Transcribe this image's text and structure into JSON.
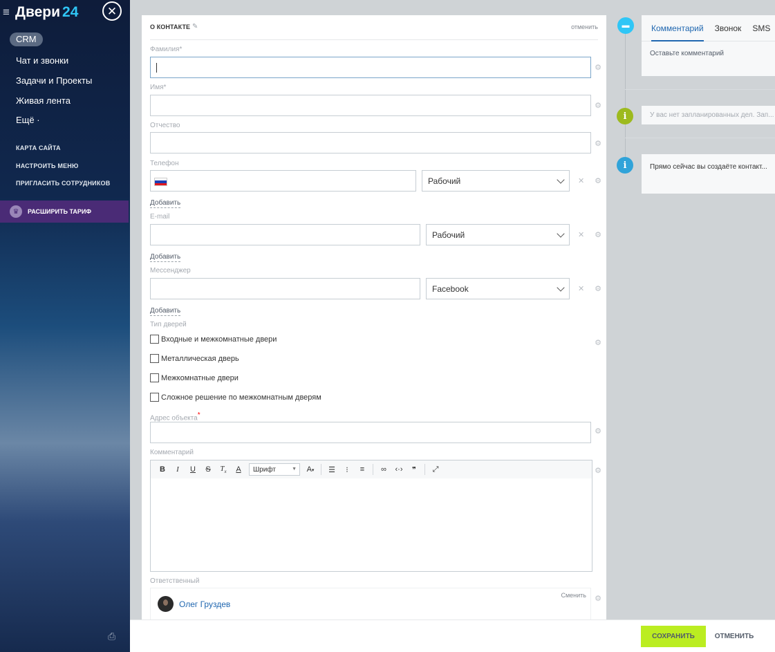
{
  "sidebar": {
    "brand": "Двери",
    "brand_num": "24",
    "crm": "CRM",
    "items": [
      {
        "label": "Чат и звонки"
      },
      {
        "label": "Задачи и Проекты"
      },
      {
        "label": "Живая лента"
      },
      {
        "label": "Ещё ·"
      }
    ],
    "links": [
      {
        "label": "КАРТА САЙТА"
      },
      {
        "label": "НАСТРОИТЬ МЕНЮ"
      },
      {
        "label": "ПРИГЛАСИТЬ СОТРУДНИКОВ"
      }
    ],
    "upgrade": "РАСШИРИТЬ ТАРИФ"
  },
  "form": {
    "title": "О КОНТАКТЕ",
    "cancel": "отменить",
    "fields": {
      "lastname": {
        "label": "Фамилия",
        "required": "*",
        "value": ""
      },
      "firstname": {
        "label": "Имя",
        "required": "*",
        "value": ""
      },
      "middlename": {
        "label": "Отчество",
        "value": ""
      },
      "phone": {
        "label": "Телефон",
        "value": "",
        "type": "Рабочий",
        "add": "Добавить"
      },
      "email": {
        "label": "E-mail",
        "value": "",
        "type": "Рабочий",
        "add": "Добавить"
      },
      "messenger": {
        "label": "Мессенджер",
        "value": "",
        "type": "Facebook",
        "add": "Добавить"
      },
      "door_type": {
        "label": "Тип дверей",
        "options": [
          {
            "label": "Входные и межкомнатные двери",
            "checked": false
          },
          {
            "label": "Металлическая дверь",
            "checked": false
          },
          {
            "label": "Межкомнатные двери",
            "checked": false
          },
          {
            "label": "Сложное решение по межкомнатным дверям",
            "checked": false
          }
        ]
      },
      "address": {
        "label": "Адрес объекта",
        "required": "*",
        "value": ""
      },
      "comment": {
        "label": "Комментарий",
        "font": "Шрифт",
        "value": ""
      },
      "responsible": {
        "label": "Ответственный",
        "name": "Олег Груздев",
        "change": "Сменить"
      }
    }
  },
  "timeline": {
    "tabs": [
      {
        "label": "Комментарий",
        "active": true
      },
      {
        "label": "Звонок",
        "active": false
      },
      {
        "label": "SMS",
        "active": false
      }
    ],
    "comment_placeholder": "Оставьте комментарий",
    "no_plans": "У вас нет запланированных дел. Зап...",
    "creating": "Прямо сейчас вы создаёте контакт..."
  },
  "footer": {
    "save": "СОХРАНИТЬ",
    "cancel": "ОТМЕНИТЬ"
  },
  "colors": {
    "accent": "#2067b0",
    "save_bg": "#bbed21",
    "upgrade_bg": "#4a2b76",
    "chat_icon": "#2fc6f6",
    "info_green": "#9dba1e",
    "info_blue": "#30a3d9"
  }
}
